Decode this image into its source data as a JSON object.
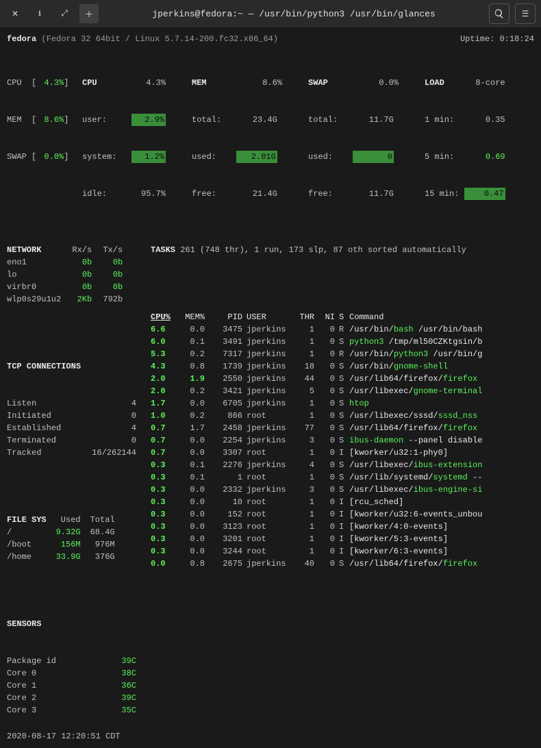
{
  "title": "jperkins@fedora:~ — /usr/bin/python3 /usr/bin/glances",
  "hostname": "fedora",
  "osline": "(Fedora 32 64bit / Linux 5.7.14-200.fc32.x86_64)",
  "uptime_label": "Uptime:",
  "uptime": "0:18:24",
  "bar": {
    "cpu_label": "CPU",
    "cpu": "4.3%",
    "mem_label": "MEM",
    "mem": "8.6%",
    "swap_label": "SWAP",
    "swap": "0.0%"
  },
  "cpu": {
    "hdr": "CPU",
    "pct": "4.3%",
    "user_l": "user:",
    "user": "2.9%",
    "system_l": "system:",
    "system": "1.2%",
    "idle_l": "idle:",
    "idle": "95.7%"
  },
  "mem": {
    "hdr": "MEM",
    "pct": "8.6%",
    "total_l": "total:",
    "total": "23.4G",
    "used_l": "used:",
    "used": "2.01G",
    "free_l": "free:",
    "free": "21.4G"
  },
  "swap": {
    "hdr": "SWAP",
    "pct": "0.0%",
    "total_l": "total:",
    "total": "11.7G",
    "used_l": "used:",
    "used": "0",
    "free_l": "free:",
    "free": "11.7G"
  },
  "load": {
    "hdr": "LOAD",
    "cores": "8-core",
    "l1": "1 min:",
    "v1": "0.35",
    "l5": "5 min:",
    "v5": "0.69",
    "l15": "15 min:",
    "v15": "0.47"
  },
  "network": {
    "hdr": "NETWORK",
    "rxh": "Rx/s",
    "txh": "Tx/s",
    "ifaces": [
      {
        "n": "eno1",
        "rx": "0b",
        "tx": "0b"
      },
      {
        "n": "lo",
        "rx": "0b",
        "tx": "0b"
      },
      {
        "n": "virbr0",
        "rx": "0b",
        "tx": "0b"
      },
      {
        "n": "wlp0s29u1u2",
        "rx": "2Kb",
        "tx": "792b"
      }
    ]
  },
  "tcp": {
    "hdr": "TCP CONNECTIONS",
    "rows": [
      {
        "n": "Listen",
        "v": "4"
      },
      {
        "n": "Initiated",
        "v": "0"
      },
      {
        "n": "Established",
        "v": "4"
      },
      {
        "n": "Terminated",
        "v": "0"
      },
      {
        "n": "Tracked",
        "v": "16/262144"
      }
    ]
  },
  "fs": {
    "hdr": "FILE SYS",
    "uh": "Used",
    "th": "Total",
    "rows": [
      {
        "n": "/",
        "u": "9.32G",
        "t": "68.4G"
      },
      {
        "n": "/boot",
        "u": "156M",
        "t": "976M"
      },
      {
        "n": "/home",
        "u": "33.9G",
        "t": "376G"
      }
    ]
  },
  "sensors": {
    "hdr": "SENSORS",
    "rows": [
      {
        "n": "Package id",
        "v": "39C"
      },
      {
        "n": "Core 0",
        "v": "38C"
      },
      {
        "n": "Core 1",
        "v": "36C"
      },
      {
        "n": "Core 2",
        "v": "39C"
      },
      {
        "n": "Core 3",
        "v": "35C"
      }
    ]
  },
  "tasks_line": "TASKS 261 (748 thr), 1 run, 173 slp, 87 oth sorted automatically",
  "proc_hdr": {
    "cpu": "CPU%",
    "mem": "MEM%",
    "pid": "PID",
    "user": "USER",
    "thr": "THR",
    "ni": "NI",
    "s": "S",
    "cmd": "Command"
  },
  "procs": [
    {
      "cpu": "6.6",
      "mem": "0.0",
      "pid": "3475",
      "user": "jperkins",
      "thr": "1",
      "ni": "0",
      "s": "R",
      "cmd": [
        [
          "/usr/bin/",
          "w"
        ],
        [
          "bash",
          "g"
        ],
        [
          " /usr/bin/bash",
          "w"
        ]
      ]
    },
    {
      "cpu": "6.0",
      "mem": "0.1",
      "pid": "3491",
      "user": "jperkins",
      "thr": "1",
      "ni": "0",
      "s": "S",
      "cmd": [
        [
          "python3",
          "g"
        ],
        [
          " /tmp/ml50CZKtgsin/b",
          "w"
        ]
      ]
    },
    {
      "cpu": "5.3",
      "mem": "0.2",
      "pid": "7317",
      "user": "jperkins",
      "thr": "1",
      "ni": "0",
      "s": "R",
      "cmd": [
        [
          "/usr/bin/",
          "w"
        ],
        [
          "python3",
          "g"
        ],
        [
          " /usr/bin/g",
          "w"
        ]
      ]
    },
    {
      "cpu": "4.3",
      "mem": "0.8",
      "pid": "1739",
      "user": "jperkins",
      "thr": "18",
      "ni": "0",
      "s": "S",
      "cmd": [
        [
          "/usr/bin/",
          "w"
        ],
        [
          "gnome-shell",
          "g"
        ]
      ]
    },
    {
      "cpu": "2.0",
      "mem": "1.9",
      "memhl": true,
      "pid": "2550",
      "user": "jperkins",
      "thr": "44",
      "ni": "0",
      "s": "S",
      "cmd": [
        [
          "/usr/lib64/firefox/",
          "w"
        ],
        [
          "firefox",
          "g"
        ]
      ]
    },
    {
      "cpu": "2.0",
      "mem": "0.2",
      "pid": "3421",
      "user": "jperkins",
      "thr": "5",
      "ni": "0",
      "s": "S",
      "cmd": [
        [
          "/usr/libexec/",
          "w"
        ],
        [
          "gnome-terminal",
          "g"
        ]
      ]
    },
    {
      "cpu": "1.7",
      "mem": "0.0",
      "pid": "6705",
      "user": "jperkins",
      "thr": "1",
      "ni": "0",
      "s": "S",
      "cmd": [
        [
          "htop",
          "g"
        ]
      ]
    },
    {
      "cpu": "1.0",
      "mem": "0.2",
      "pid": "866",
      "user": "root",
      "thr": "1",
      "ni": "0",
      "s": "S",
      "cmd": [
        [
          "/usr/libexec/sssd/",
          "w"
        ],
        [
          "sssd_nss",
          "g"
        ]
      ]
    },
    {
      "cpu": "0.7",
      "mem": "1.7",
      "pid": "2458",
      "user": "jperkins",
      "thr": "77",
      "ni": "0",
      "s": "S",
      "cmd": [
        [
          "/usr/lib64/firefox/",
          "w"
        ],
        [
          "firefox",
          "g"
        ]
      ]
    },
    {
      "cpu": "0.7",
      "mem": "0.0",
      "pid": "2254",
      "user": "jperkins",
      "thr": "3",
      "ni": "0",
      "s": "S",
      "cmd": [
        [
          "ibus-daemon",
          "g"
        ],
        [
          " --panel disable",
          "w"
        ]
      ]
    },
    {
      "cpu": "0.7",
      "mem": "0.0",
      "pid": "3307",
      "user": "root",
      "thr": "1",
      "ni": "0",
      "s": "I",
      "cmd": [
        [
          "[kworker/u32:1-phy0]",
          "w"
        ]
      ]
    },
    {
      "cpu": "0.3",
      "mem": "0.1",
      "pid": "2276",
      "user": "jperkins",
      "thr": "4",
      "ni": "0",
      "s": "S",
      "cmd": [
        [
          "/usr/libexec/",
          "w"
        ],
        [
          "ibus-extension",
          "g"
        ]
      ]
    },
    {
      "cpu": "0.3",
      "mem": "0.1",
      "pid": "1",
      "user": "root",
      "thr": "1",
      "ni": "0",
      "s": "S",
      "cmd": [
        [
          "/usr/lib/systemd/",
          "w"
        ],
        [
          "systemd",
          "g"
        ],
        [
          " --",
          "w"
        ]
      ]
    },
    {
      "cpu": "0.3",
      "mem": "0.0",
      "pid": "2332",
      "user": "jperkins",
      "thr": "3",
      "ni": "0",
      "s": "S",
      "cmd": [
        [
          "/usr/libexec/",
          "w"
        ],
        [
          "ibus-engine-si",
          "g"
        ]
      ]
    },
    {
      "cpu": "0.3",
      "mem": "0.0",
      "pid": "10",
      "user": "root",
      "thr": "1",
      "ni": "0",
      "s": "I",
      "cmd": [
        [
          "[rcu_sched]",
          "w"
        ]
      ]
    },
    {
      "cpu": "0.3",
      "mem": "0.0",
      "pid": "152",
      "user": "root",
      "thr": "1",
      "ni": "0",
      "s": "I",
      "cmd": [
        [
          "[kworker/u32:6-events_unbou",
          "w"
        ]
      ]
    },
    {
      "cpu": "0.3",
      "mem": "0.0",
      "pid": "3123",
      "user": "root",
      "thr": "1",
      "ni": "0",
      "s": "I",
      "cmd": [
        [
          "[kworker/4:0-events]",
          "w"
        ]
      ]
    },
    {
      "cpu": "0.3",
      "mem": "0.0",
      "pid": "3201",
      "user": "root",
      "thr": "1",
      "ni": "0",
      "s": "I",
      "cmd": [
        [
          "[kworker/5:3-events]",
          "w"
        ]
      ]
    },
    {
      "cpu": "0.3",
      "mem": "0.0",
      "pid": "3244",
      "user": "root",
      "thr": "1",
      "ni": "0",
      "s": "I",
      "cmd": [
        [
          "[kworker/6:3-events]",
          "w"
        ]
      ]
    },
    {
      "cpu": "0.0",
      "mem": "0.8",
      "pid": "2675",
      "user": "jperkins",
      "thr": "40",
      "ni": "0",
      "s": "S",
      "cmd": [
        [
          "/usr/lib64/firefox/",
          "w"
        ],
        [
          "firefox",
          "g"
        ]
      ]
    }
  ],
  "timestamp": "2020-08-17 12:20:51 CDT"
}
